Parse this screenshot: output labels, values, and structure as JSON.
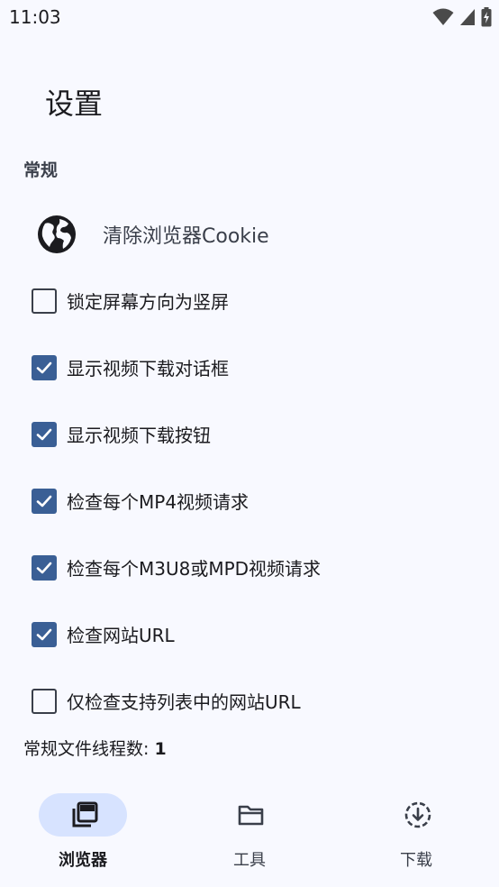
{
  "status_bar": {
    "time": "11:03"
  },
  "page": {
    "title": "设置"
  },
  "sections": {
    "general": {
      "header": "常规"
    }
  },
  "prefs": {
    "clear_cookie": {
      "label": "清除浏览器Cookie",
      "icon": "globe-icon"
    }
  },
  "checks": [
    {
      "label": "锁定屏幕方向为竖屏",
      "checked": false
    },
    {
      "label": "显示视频下载对话框",
      "checked": true
    },
    {
      "label": "显示视频下载按钮",
      "checked": true
    },
    {
      "label": "检查每个MP4视频请求",
      "checked": true
    },
    {
      "label": "检查每个M3U8或MPD视频请求",
      "checked": true
    },
    {
      "label": "检查网站URL",
      "checked": true
    },
    {
      "label": "仅检查支持列表中的网站URL",
      "checked": false
    }
  ],
  "threads": {
    "label": "常规文件线程数: ",
    "value": "1"
  },
  "bottom_nav": [
    {
      "label": "浏览器",
      "icon": "browser-tabs-icon",
      "active": true
    },
    {
      "label": "工具",
      "icon": "folder-icon",
      "active": false
    },
    {
      "label": "下载",
      "icon": "download-icon",
      "active": false
    }
  ],
  "colors": {
    "accent": "#3a5f95",
    "background": "#f8f9ff",
    "active_pill": "#d7e3ff"
  }
}
